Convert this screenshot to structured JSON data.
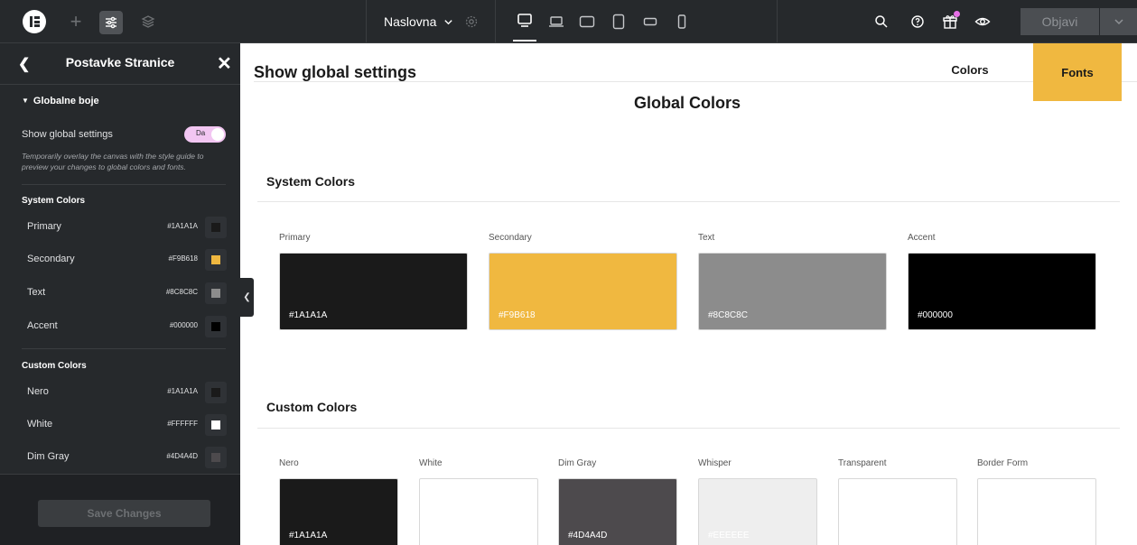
{
  "topbar": {
    "page_name": "Naslovna",
    "publish_label": "Objavi",
    "icons": [
      "elementor-logo-icon",
      "plus-icon",
      "site-settings-icon",
      "layers-icon",
      "chevron-down-icon",
      "gear-icon",
      "desktop-icon",
      "laptop-icon",
      "tablet-landscape-icon",
      "tablet-portrait-icon",
      "mobile-landscape-icon",
      "mobile-portrait-icon",
      "search-icon",
      "help-icon",
      "gift-icon",
      "eye-icon"
    ]
  },
  "panel": {
    "title": "Postavke Stranice",
    "section_title": "Globalne boje",
    "show_global_label": "Show global settings",
    "toggle_label": "Da",
    "hint": "Temporarily overlay the canvas with the style guide to preview your changes to global colors and fonts.",
    "system_title": "System Colors",
    "system_colors": [
      {
        "name": "Primary",
        "hex": "#1A1A1A",
        "color": "#1A1A1A"
      },
      {
        "name": "Secondary",
        "hex": "#F9B618",
        "color": "#F0B840"
      },
      {
        "name": "Text",
        "hex": "#8C8C8C",
        "color": "#8C8C8C"
      },
      {
        "name": "Accent",
        "hex": "#000000",
        "color": "#000000"
      }
    ],
    "custom_title": "Custom Colors",
    "custom_colors": [
      {
        "name": "Nero",
        "hex": "#1A1A1A",
        "color": "#1A1A1A"
      },
      {
        "name": "White",
        "hex": "#FFFFFF",
        "color": "#FFFFFF"
      },
      {
        "name": "Dim Gray",
        "hex": "#4D4A4D",
        "color": "#4D4A4D"
      }
    ],
    "save_label": "Save Changes"
  },
  "canvas": {
    "title": "Show global settings",
    "tab_colors": "Colors",
    "tab_fonts": "Fonts",
    "heading": "Global Colors",
    "system_heading": "System Colors",
    "system_swatches": [
      {
        "label": "Primary",
        "hex": "#1A1A1A",
        "color": "#1A1A1A",
        "text_color": "#FFFFFF"
      },
      {
        "label": "Secondary",
        "hex": "#F9B618",
        "color": "#F0B840",
        "text_color": "#FFFFFF"
      },
      {
        "label": "Text",
        "hex": "#8C8C8C",
        "color": "#8C8C8C",
        "text_color": "#FFFFFF"
      },
      {
        "label": "Accent",
        "hex": "#000000",
        "color": "#000000",
        "text_color": "#FFFFFF"
      }
    ],
    "custom_heading": "Custom Colors",
    "custom_swatches": [
      {
        "label": "Nero",
        "hex": "#1A1A1A",
        "color": "#1A1A1A",
        "text_color": "#FFFFFF"
      },
      {
        "label": "White",
        "hex": "",
        "color": "#FFFFFF",
        "text_color": "#FFFFFF"
      },
      {
        "label": "Dim Gray",
        "hex": "#4D4A4D",
        "color": "#4D4A4D",
        "text_color": "#FFFFFF"
      },
      {
        "label": "Whisper",
        "hex": "#EEEEEE",
        "color": "#EEEEEE",
        "text_color": "#FFFFFF"
      },
      {
        "label": "Transparent",
        "hex": "",
        "color": "#FFFFFF",
        "text_color": "#FFFFFF"
      },
      {
        "label": "Border Form",
        "hex": "",
        "color": "#FFFFFF",
        "text_color": "#FFFFFF"
      }
    ]
  }
}
